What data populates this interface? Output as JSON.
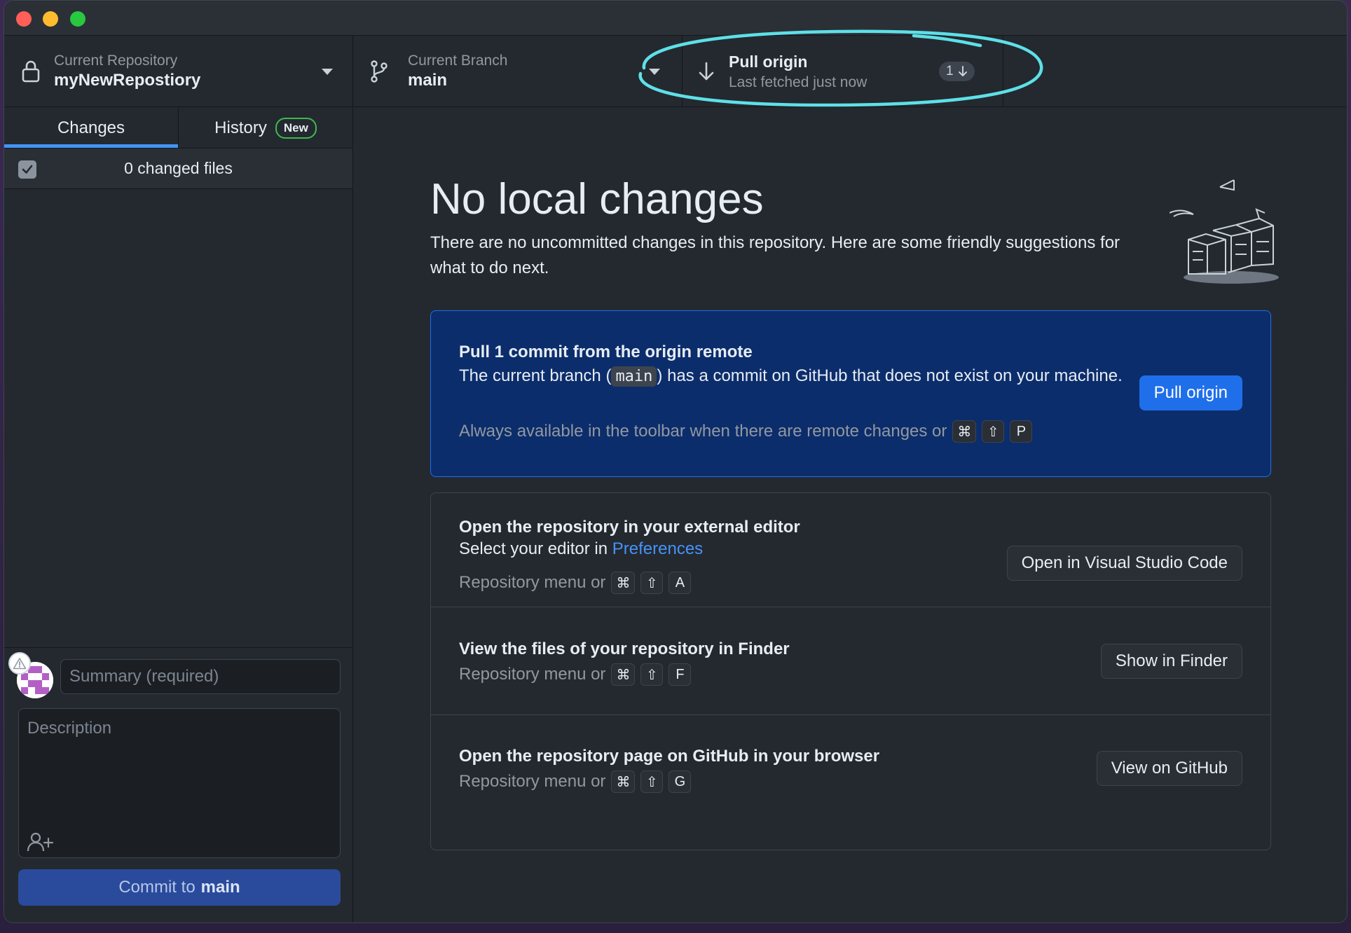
{
  "toolbar": {
    "repo": {
      "label": "Current Repository",
      "name": "myNewRepostiory"
    },
    "branch": {
      "label": "Current Branch",
      "name": "main"
    },
    "pull": {
      "title": "Pull origin",
      "subtitle": "Last fetched just now",
      "count": "1"
    }
  },
  "sidebar": {
    "tabs": [
      {
        "label": "Changes"
      },
      {
        "label": "History",
        "badge": "New"
      }
    ],
    "changed_files": "0 changed files",
    "commit": {
      "summary_placeholder": "Summary (required)",
      "description_placeholder": "Description",
      "button_prefix": "Commit to",
      "button_branch": "main"
    }
  },
  "main": {
    "title": "No local changes",
    "description": "There are no uncommitted changes in this repository. Here are some friendly suggestions for what to do next.",
    "pull_card": {
      "title": "Pull 1 commit from the origin remote",
      "text_before": "The current branch (",
      "branch": "main",
      "text_after": ") has a commit on GitHub that does not exist on your machine.",
      "hint": "Always available in the toolbar when there are remote changes or",
      "keys": [
        "⌘",
        "⇧",
        "P"
      ],
      "button": "Pull origin"
    },
    "editor_card": {
      "title": "Open the repository in your external editor",
      "text": "Select your editor in",
      "link": "Preferences",
      "hint": "Repository menu or",
      "keys": [
        "⌘",
        "⇧",
        "A"
      ],
      "button": "Open in Visual Studio Code"
    },
    "finder_card": {
      "title": "View the files of your repository in Finder",
      "hint": "Repository menu or",
      "keys": [
        "⌘",
        "⇧",
        "F"
      ],
      "button": "Show in Finder"
    },
    "github_card": {
      "title": "Open the repository page on GitHub in your browser",
      "hint": "Repository menu or",
      "keys": [
        "⌘",
        "⇧",
        "G"
      ],
      "button": "View on GitHub"
    }
  },
  "colors": {
    "accent": "#1f6feb",
    "annotation": "#5ee0e8",
    "new_badge": "#3fb950",
    "close": "#ff5f57",
    "minimize": "#febc2e",
    "zoom": "#28c840"
  },
  "icons": [
    "lock-icon",
    "branch-icon",
    "arrow-down-icon",
    "chevron-down-icon",
    "checkbox-icon",
    "warning-icon",
    "add-person-icon"
  ]
}
